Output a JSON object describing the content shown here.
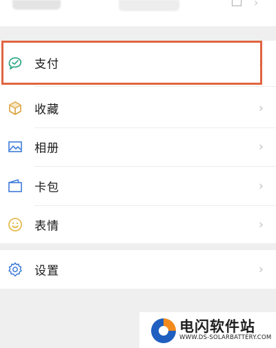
{
  "menu": {
    "items": [
      {
        "label": "支付",
        "icon": "wechat-pay-icon",
        "highlighted": true
      },
      {
        "label": "收藏",
        "icon": "cube-icon"
      },
      {
        "label": "相册",
        "icon": "picture-icon"
      },
      {
        "label": "卡包",
        "icon": "wallet-icon"
      },
      {
        "label": "表情",
        "icon": "smiley-icon"
      }
    ],
    "settings": {
      "label": "设置",
      "icon": "gear-icon"
    }
  },
  "chevron": "›",
  "watermark": {
    "title": "电闪软件站",
    "url": "WWW.DS-SOLARBATTERY.COM"
  },
  "colors": {
    "highlight": "#e0643f",
    "icon": "#36a88a",
    "background": "#efefef"
  }
}
